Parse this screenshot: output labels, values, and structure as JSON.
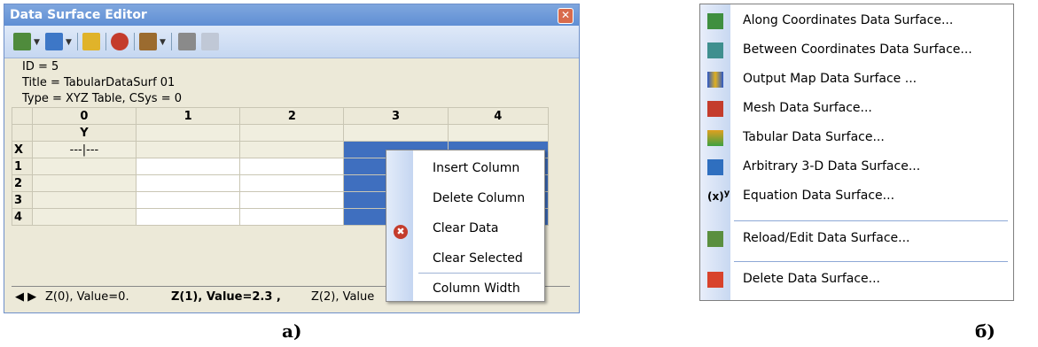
{
  "editor": {
    "title": "Data Surface Editor",
    "close_glyph": "✕",
    "info": {
      "id": "ID = 5",
      "title": "Title = TabularDataSurf 01",
      "type": "Type = XYZ Table, CSys = 0"
    },
    "grid": {
      "col_headers": [
        "0",
        "1",
        "2",
        "3",
        "4"
      ],
      "sub_header": "Y",
      "row_headers": [
        "X",
        "1",
        "2",
        "3",
        "4"
      ],
      "origin_cell": "---|---"
    },
    "tabs": {
      "nav": "◀ ▶",
      "tab1": "Z(0), Value=0.",
      "tab2": "Z(1), Value=2.3 ,",
      "tab3": "Z(2), Value"
    }
  },
  "context_menu": {
    "items": [
      "Insert Column",
      "Delete Column",
      "Clear Data",
      "Clear Selected",
      "Column Width"
    ]
  },
  "captions": {
    "left": "а)",
    "right": "б)"
  },
  "menu": {
    "items": [
      {
        "label": "Along Coordinates Data Surface...",
        "icon": "along-coordinates-icon"
      },
      {
        "label": "Between Coordinates Data Surface...",
        "icon": "between-coordinates-icon"
      },
      {
        "label": "Output Map Data Surface ...",
        "icon": "output-map-icon"
      },
      {
        "label": "Mesh Data Surface...",
        "icon": "mesh-icon"
      },
      {
        "label": "Tabular Data Surface...",
        "icon": "tabular-icon"
      },
      {
        "label": "Arbitrary 3-D Data Surface...",
        "icon": "arbitrary-3d-icon"
      },
      {
        "label": "Equation Data Surface...",
        "icon": "equation-icon"
      },
      {
        "label": "Reload/Edit Data Surface...",
        "icon": "reload-icon"
      },
      {
        "label": "Delete Data Surface...",
        "icon": "delete-icon"
      }
    ]
  },
  "colors": {
    "title_bar": "#6b97d8",
    "selection": "#3f6fbf",
    "close_button": "#d86b4c"
  }
}
